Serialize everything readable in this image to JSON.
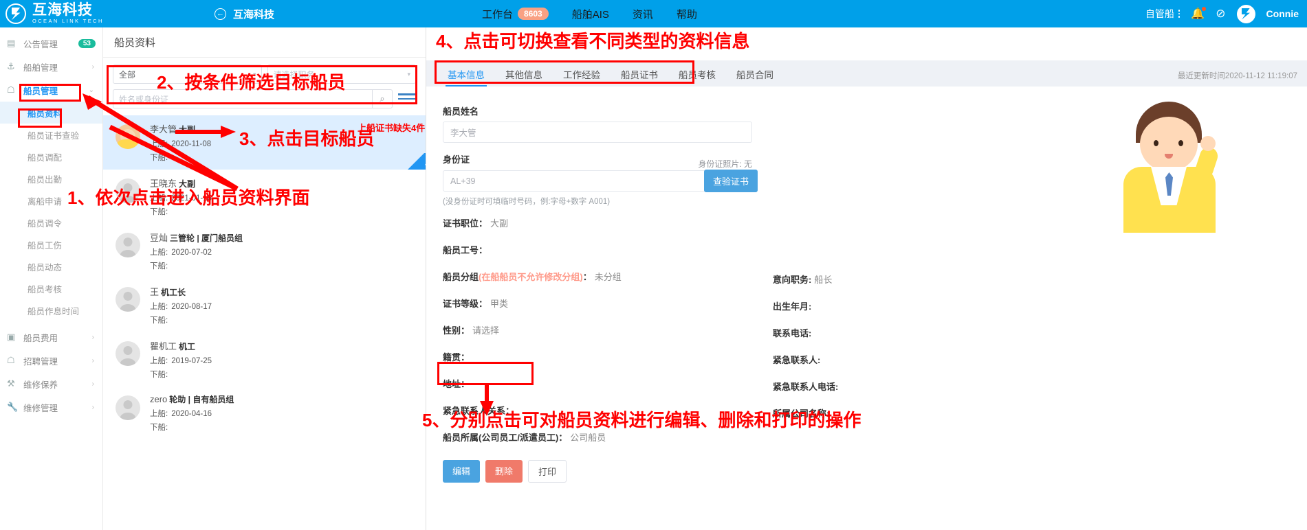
{
  "topbar": {
    "logo_cn": "互海科技",
    "logo_en": "OCEAN LINK TECH",
    "back_title": "互海科技",
    "nav": [
      {
        "label": "工作台",
        "badge": "8603"
      },
      {
        "label": "船舶AIS",
        "badge": ""
      },
      {
        "label": "资讯",
        "badge": ""
      },
      {
        "label": "帮助",
        "badge": ""
      }
    ],
    "self_ship": "自管船",
    "user_name": "Connie"
  },
  "sidebar": {
    "items": [
      {
        "label": "公告管理",
        "icon": "megaphone-icon",
        "count": "53",
        "chevron": false
      },
      {
        "label": "船舶管理",
        "icon": "anchor-icon",
        "count": "",
        "chevron": true
      },
      {
        "label": "船员管理",
        "icon": "person-icon",
        "count": "",
        "chevron": true,
        "open": true
      }
    ],
    "sub_items": [
      {
        "label": "船员资料",
        "active": true
      },
      {
        "label": "船员证书查验",
        "active": false
      },
      {
        "label": "船员调配",
        "active": false
      },
      {
        "label": "船员出勤",
        "active": false
      },
      {
        "label": "离船申请",
        "active": false
      },
      {
        "label": "船员调令",
        "active": false
      },
      {
        "label": "船员工伤",
        "active": false
      },
      {
        "label": "船员动态",
        "active": false
      },
      {
        "label": "船员考核",
        "active": false
      },
      {
        "label": "船员作息时间",
        "active": false
      }
    ],
    "items_bottom": [
      {
        "label": "船员费用",
        "icon": "card-icon",
        "chevron": true
      },
      {
        "label": "招聘管理",
        "icon": "recruit-icon",
        "chevron": true
      },
      {
        "label": "维修保养",
        "icon": "tool-icon",
        "chevron": true
      },
      {
        "label": "维修管理",
        "icon": "wrench-icon",
        "chevron": true
      }
    ]
  },
  "crew_panel": {
    "title": "船员资料",
    "filter_all": "全部",
    "filter_position_placeholder": "请选择职务",
    "search_placeholder": "姓名或身份证",
    "items": [
      {
        "name": "李大管",
        "role": "大副",
        "group": "",
        "onboard_label": "上船:",
        "onboard": "2020-11-08",
        "offboard_label": "下船:",
        "offboard": "",
        "selected": true,
        "has_photo": true
      },
      {
        "name": "王晓东",
        "role": "大副",
        "group": "",
        "onboard_label": "上船:",
        "onboard": "2021-01-16",
        "offboard_label": "下船:",
        "offboard": "",
        "selected": false,
        "has_photo": false
      },
      {
        "name": "豆灿",
        "role": "三管轮 | 厦门船员组",
        "group": "",
        "onboard_label": "上船:",
        "onboard": "2020-07-02",
        "offboard_label": "下船:",
        "offboard": "",
        "selected": false,
        "has_photo": false
      },
      {
        "name": "王",
        "role": "机工长",
        "group": "",
        "onboard_label": "上船:",
        "onboard": "2020-08-17",
        "offboard_label": "下船:",
        "offboard": "",
        "selected": false,
        "has_photo": false
      },
      {
        "name": "瞿机工",
        "role": "机工",
        "group": "",
        "onboard_label": "上船:",
        "onboard": "2019-07-25",
        "offboard_label": "下船:",
        "offboard": "",
        "selected": false,
        "has_photo": false
      },
      {
        "name": "zero",
        "role": "轮助 | 自有船员组",
        "group": "",
        "onboard_label": "上船:",
        "onboard": "2020-04-16",
        "offboard_label": "下船:",
        "offboard": "",
        "selected": false,
        "has_photo": false
      }
    ],
    "missing_cert_note": "上船证书缺失4件"
  },
  "detail": {
    "tabs": [
      {
        "label": "基本信息",
        "active": true
      },
      {
        "label": "其他信息",
        "active": false
      },
      {
        "label": "工作经验",
        "active": false
      },
      {
        "label": "船员证书",
        "active": false
      },
      {
        "label": "船员考核",
        "active": false
      },
      {
        "label": "船员合同",
        "active": false
      }
    ],
    "update_time": "最近更新时间2020-11-12 11:19:07",
    "name_label": "船员姓名",
    "name_value": "李大管",
    "id_label": "身份证",
    "id_photo_label": "身份证照片: 无",
    "id_value": "AL+39",
    "verify_button": "查验证书",
    "id_hint": "(没身份证时可填临时号码，例:字母+数字 A001)",
    "left_fields": [
      {
        "label": "证书职位：",
        "value": "大副",
        "warn": ""
      },
      {
        "label": "船员工号：",
        "value": "",
        "warn": ""
      },
      {
        "label": "船员分组",
        "value": "未分组",
        "warn": "(在船船员不允许修改分组)",
        "suffix": "："
      },
      {
        "label": "证书等级：",
        "value": "甲类",
        "warn": ""
      },
      {
        "label": "性别：",
        "value": "请选择",
        "warn": ""
      },
      {
        "label": "籍贯：",
        "value": "",
        "warn": ""
      },
      {
        "label": "地址：",
        "value": "",
        "warn": ""
      },
      {
        "label": "紧急联系人关系：",
        "value": "",
        "warn": ""
      },
      {
        "label": "船员所属(公司员工/派遣员工)：",
        "value": "公司船员",
        "warn": ""
      }
    ],
    "right_fields": [
      {
        "label": "意向职务:",
        "value": "船长"
      },
      {
        "label": "出生年月:",
        "value": ""
      },
      {
        "label": "联系电话:",
        "value": ""
      },
      {
        "label": "紧急联系人:",
        "value": ""
      },
      {
        "label": "紧急联系人电话:",
        "value": ""
      },
      {
        "label": "所属公司名称:",
        "value": ""
      }
    ],
    "buttons": {
      "edit": "编辑",
      "delete": "删除",
      "print": "打印"
    }
  },
  "annotations": {
    "step1": "1、依次点击进入船员资料界面",
    "step2": "2、按条件筛选目标船员",
    "step3": "3、点击目标船员",
    "step4": "4、点击可切换查看不同类型的资料信息",
    "step5": "5、分别点击可对船员资料进行编辑、删除和打印的操作"
  }
}
